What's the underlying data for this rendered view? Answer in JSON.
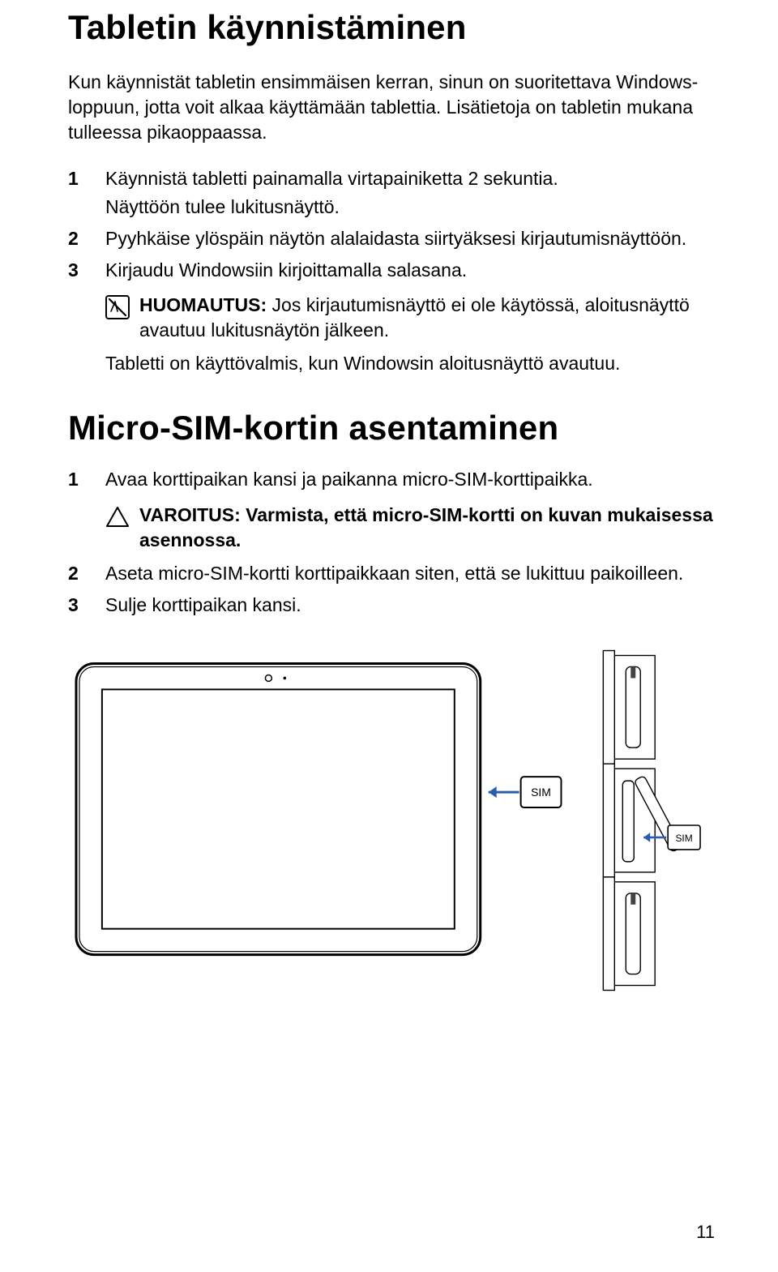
{
  "section1": {
    "title": "Tabletin käynnistäminen",
    "intro": "Kun käynnistät tabletin ensimmäisen kerran, sinun on suoritettava Windows-loppuun, jotta voit alkaa käyttämään tablettia. Lisätietoja on tabletin mukana tulleessa pikaoppaassa.",
    "steps": [
      {
        "num": "1",
        "text": "Käynnistä tabletti painamalla virtapainiketta 2 sekuntia.",
        "sub": "Näyttöön tulee lukitusnäyttö."
      },
      {
        "num": "2",
        "text": "Pyyhkäise ylöspäin näytön alalaidasta siirtyäksesi kirjautumisnäyttöön."
      },
      {
        "num": "3",
        "text": "Kirjaudu Windowsiin kirjoittamalla salasana."
      }
    ],
    "note_label": "HUOMAUTUS:",
    "note_text": " Jos kirjautumisnäyttö ei ole käytössä, aloitusnäyttö avautuu lukitusnäytön jälkeen.",
    "after_note": "Tabletti on käyttövalmis, kun Windowsin aloitusnäyttö avautuu."
  },
  "section2": {
    "title": "Micro-SIM-kortin asentaminen",
    "steps1": [
      {
        "num": "1",
        "text": "Avaa korttipaikan kansi ja paikanna micro-SIM-korttipaikka."
      }
    ],
    "caution_label": "VAROITUS:",
    "caution_text": " Varmista, että micro-SIM-kortti on kuvan mukaisessa asennossa.",
    "steps2": [
      {
        "num": "2",
        "text": "Aseta micro-SIM-kortti korttipaikkaan siten, että se lukittuu paikoilleen."
      },
      {
        "num": "3",
        "text": "Sulje korttipaikan kansi."
      }
    ]
  },
  "figure": {
    "sim_label": "SIM"
  },
  "page_number": "11"
}
